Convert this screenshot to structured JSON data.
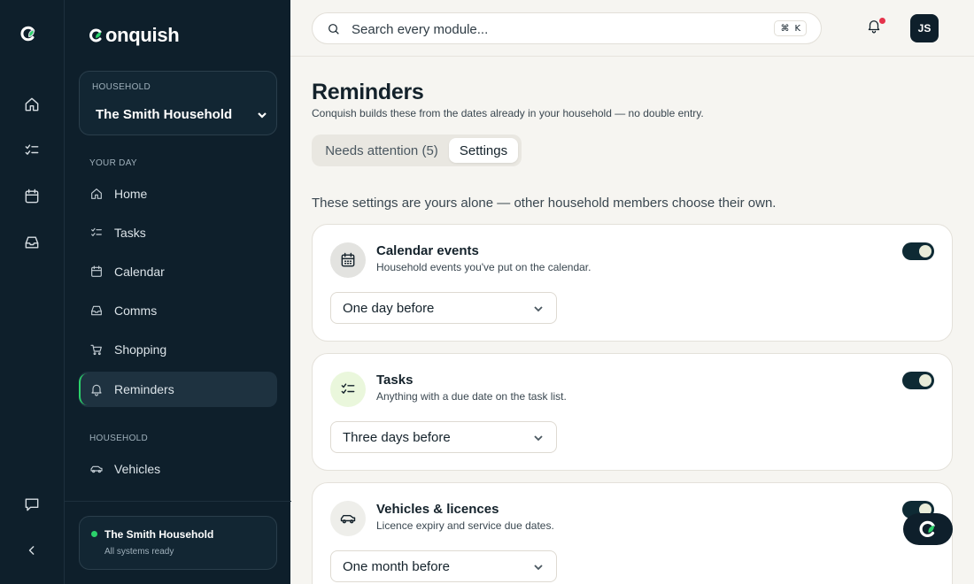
{
  "app": {
    "brand": "onquish"
  },
  "household_switcher": {
    "label": "HOUSEHOLD",
    "name": "The Smith Household"
  },
  "sidebar": {
    "section_your_day": "YOUR DAY",
    "items": [
      {
        "label": "Home",
        "icon": "home-icon"
      },
      {
        "label": "Tasks",
        "icon": "tasks-icon"
      },
      {
        "label": "Calendar",
        "icon": "calendar-icon"
      },
      {
        "label": "Comms",
        "icon": "inbox-icon"
      },
      {
        "label": "Shopping",
        "icon": "cart-icon"
      },
      {
        "label": "Reminders",
        "icon": "bell-icon",
        "active": true
      }
    ],
    "section_household": "HOUSEHOLD",
    "household_items": [
      {
        "label": "Vehicles",
        "icon": "car-icon"
      }
    ]
  },
  "status": {
    "title": "The Smith Household",
    "subtitle": "All systems ready"
  },
  "topbar": {
    "search_placeholder": "Search every module...",
    "shortcut_mod": "⌘",
    "shortcut_key": "K",
    "avatar_initials": "JS"
  },
  "page": {
    "title": "Reminders",
    "subtitle": "Conquish builds these from the dates already in your household — no double entry.",
    "tabs": [
      {
        "label": "Needs attention (5)"
      },
      {
        "label": "Settings",
        "active": true
      }
    ],
    "intro": "These settings are yours alone — other household members choose their own."
  },
  "cards": [
    {
      "title": "Calendar events",
      "description": "Household events you've put on the calendar.",
      "enabled": true,
      "timing": "One day before",
      "icon": "calendar-icon"
    },
    {
      "title": "Tasks",
      "description": "Anything with a due date on the task list.",
      "enabled": true,
      "timing": "Three days before",
      "icon": "tasks-icon"
    },
    {
      "title": "Vehicles & licences",
      "description": "Licence expiry and service due dates.",
      "enabled": true,
      "timing": "One month before",
      "icon": "car-icon"
    }
  ],
  "colors": {
    "sidebar_bg": "#0e1f2b",
    "accent_green": "#2bd16b",
    "toggle_on": "#0e2a34",
    "notification": "#e5334b",
    "tasks_icon_bg": "#eaf7dc",
    "neutral_icon_bg": "#eeeeea"
  }
}
